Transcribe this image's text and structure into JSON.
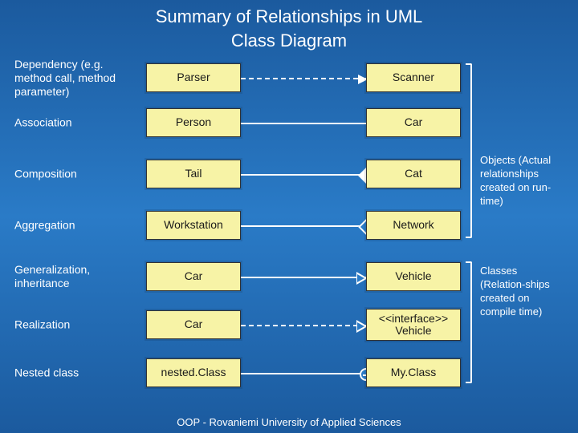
{
  "title": "Summary of Relationships in UML",
  "subtitle": "Class Diagram",
  "rows": [
    {
      "label": "Dependency\n(e.g. method call, method parameter)",
      "left": "Parser",
      "right": "Scanner"
    },
    {
      "label": "Association",
      "left": "Person",
      "right": "Car"
    },
    {
      "label": "Composition",
      "left": "Tail",
      "right": "Cat"
    },
    {
      "label": "Aggregation",
      "left": "Workstation",
      "right": "Network"
    },
    {
      "label": "Generalization, inheritance",
      "left": "Car",
      "right": "Vehicle"
    },
    {
      "label": "Realization",
      "left": "Car",
      "right": "<<interface>> Vehicle"
    },
    {
      "label": "Nested class",
      "left": "nested.Class",
      "right": "My.Class"
    }
  ],
  "sideNotes": {
    "objects": "Objects (Actual relationships created on run-time)",
    "classes": "Classes (Relation-ships created on compile time)"
  },
  "footer": "OOP - Rovaniemi University of Applied Sciences"
}
